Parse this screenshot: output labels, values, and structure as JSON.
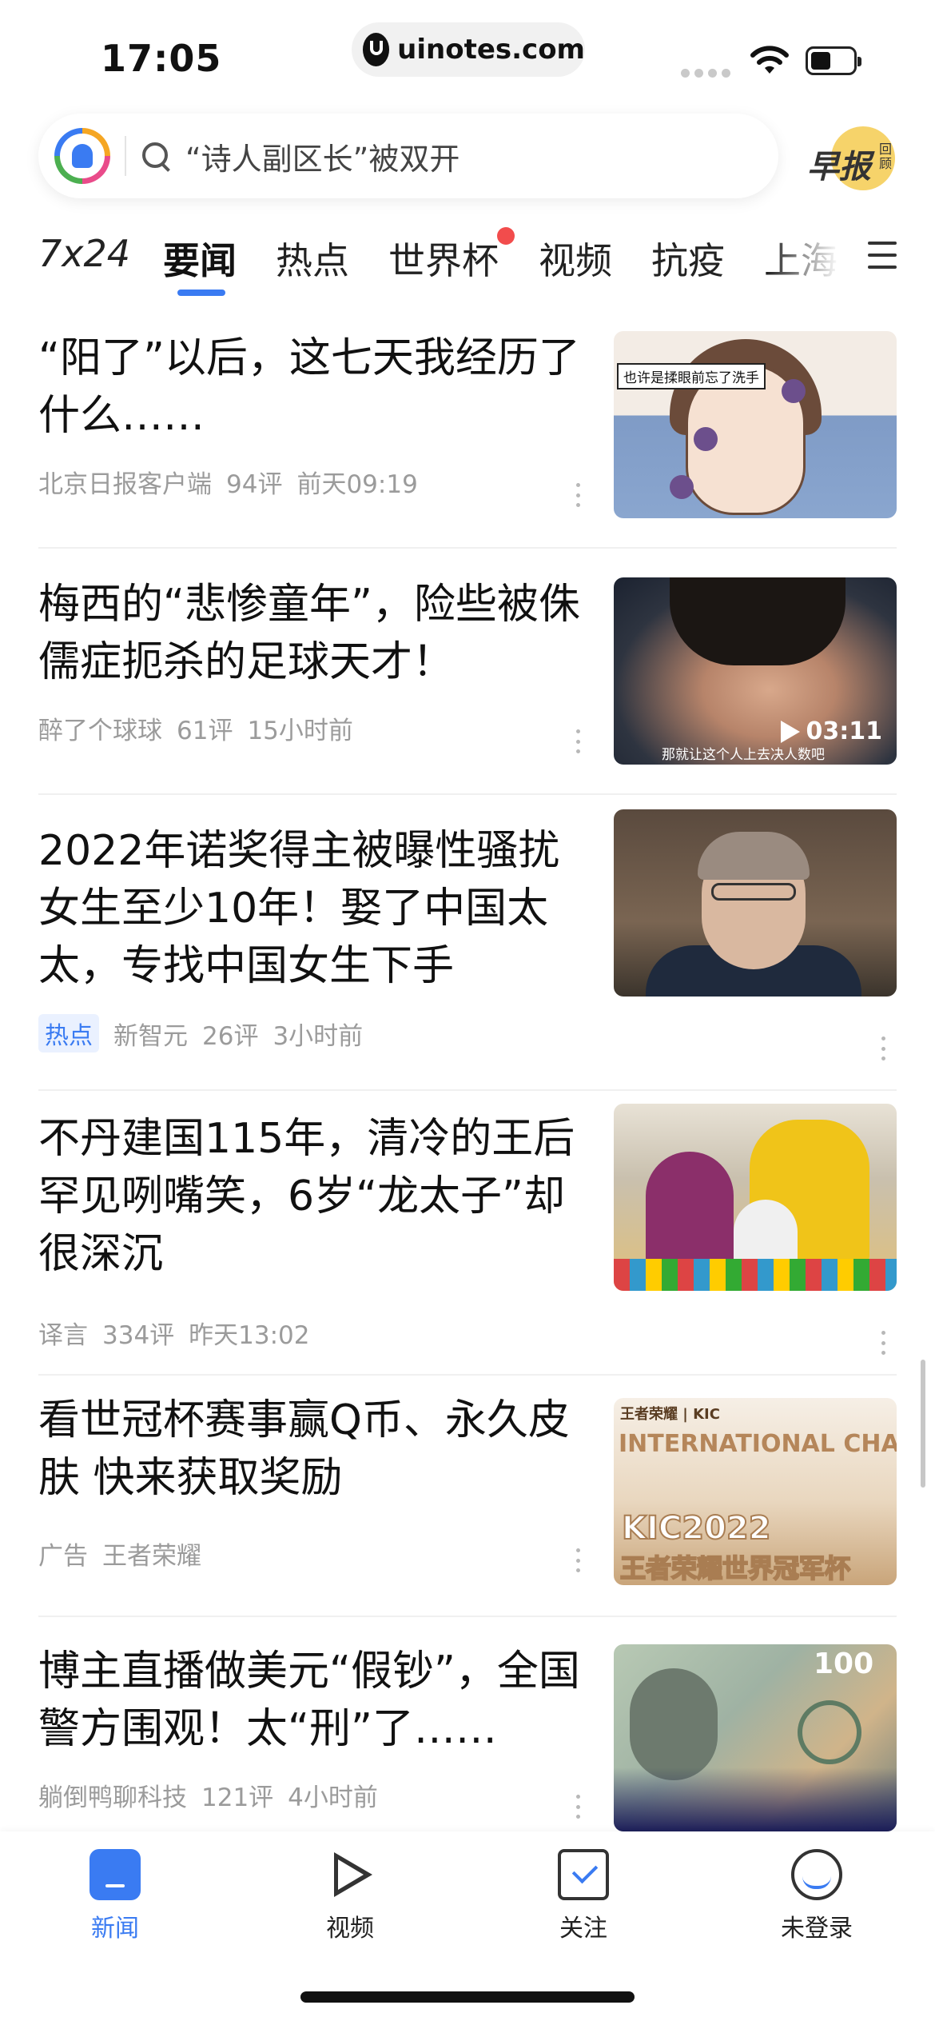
{
  "status": {
    "time": "17:05",
    "url": "uinotes.com"
  },
  "search": {
    "placeholder": "“诗人副区长”被双开"
  },
  "morning_report": {
    "label": "早报",
    "sub": "回顾"
  },
  "tabs": [
    {
      "label": "7x24"
    },
    {
      "label": "要闻",
      "active": true
    },
    {
      "label": "热点"
    },
    {
      "label": "世界杯",
      "badge": true
    },
    {
      "label": "视频"
    },
    {
      "label": "抗疫"
    },
    {
      "label": "上海"
    }
  ],
  "articles": [
    {
      "title": "“阳了”以后，这七天我经历了什么……",
      "source": "北京日报客户端",
      "comments": "94评",
      "time": "前天09:19",
      "thumb_caption": "也许是揉眼前忘了洗手"
    },
    {
      "title": "梅西的“悲惨童年”，险些被侏儒症扼杀的足球天才！",
      "source": "醉了个球球",
      "comments": "61评",
      "time": "15小时前",
      "duration": "03:11",
      "thumb_subtitle": "那就让这个人上去决人数吧"
    },
    {
      "title": "2022年诺奖得主被曝性骚扰女生至少10年！娶了中国太太，专找中国女生下手",
      "tag": "热点",
      "source": "新智元",
      "comments": "26评",
      "time": "3小时前"
    },
    {
      "title": "不丹建国115年，清冷的王后罕见咧嘴笑，6岁“龙太子”却很深沉",
      "source": "译言",
      "comments": "334评",
      "time": "昨天13:02"
    },
    {
      "title": "看世冠杯赛事赢Q币、永久皮肤 快来获取奖励",
      "source": "广告",
      "comments": "王者荣耀",
      "time": "",
      "thumb_logo": "王者荣耀 | KIC",
      "thumb_title_a": "INTERNATIONAL CHAMPIONSHIP",
      "thumb_title_b": "KIC2022",
      "thumb_title_c": "王者荣耀世界冠军杯"
    },
    {
      "title": "博主直播做美元“假钞”，全国警方围观！太“刑”了……",
      "source": "躺倒鸭聊科技",
      "comments": "121评",
      "time": "4小时前",
      "thumb_num": "100"
    }
  ],
  "bottom_nav": [
    {
      "label": "新闻",
      "icon": "news-icon",
      "active": true
    },
    {
      "label": "视频",
      "icon": "video-icon"
    },
    {
      "label": "关注",
      "icon": "follow-icon"
    },
    {
      "label": "未登录",
      "icon": "user-login-icon"
    }
  ],
  "colors": {
    "accent": "#3a7bf2",
    "badge": "#f24c4c",
    "meta": "#9b9b9b"
  }
}
